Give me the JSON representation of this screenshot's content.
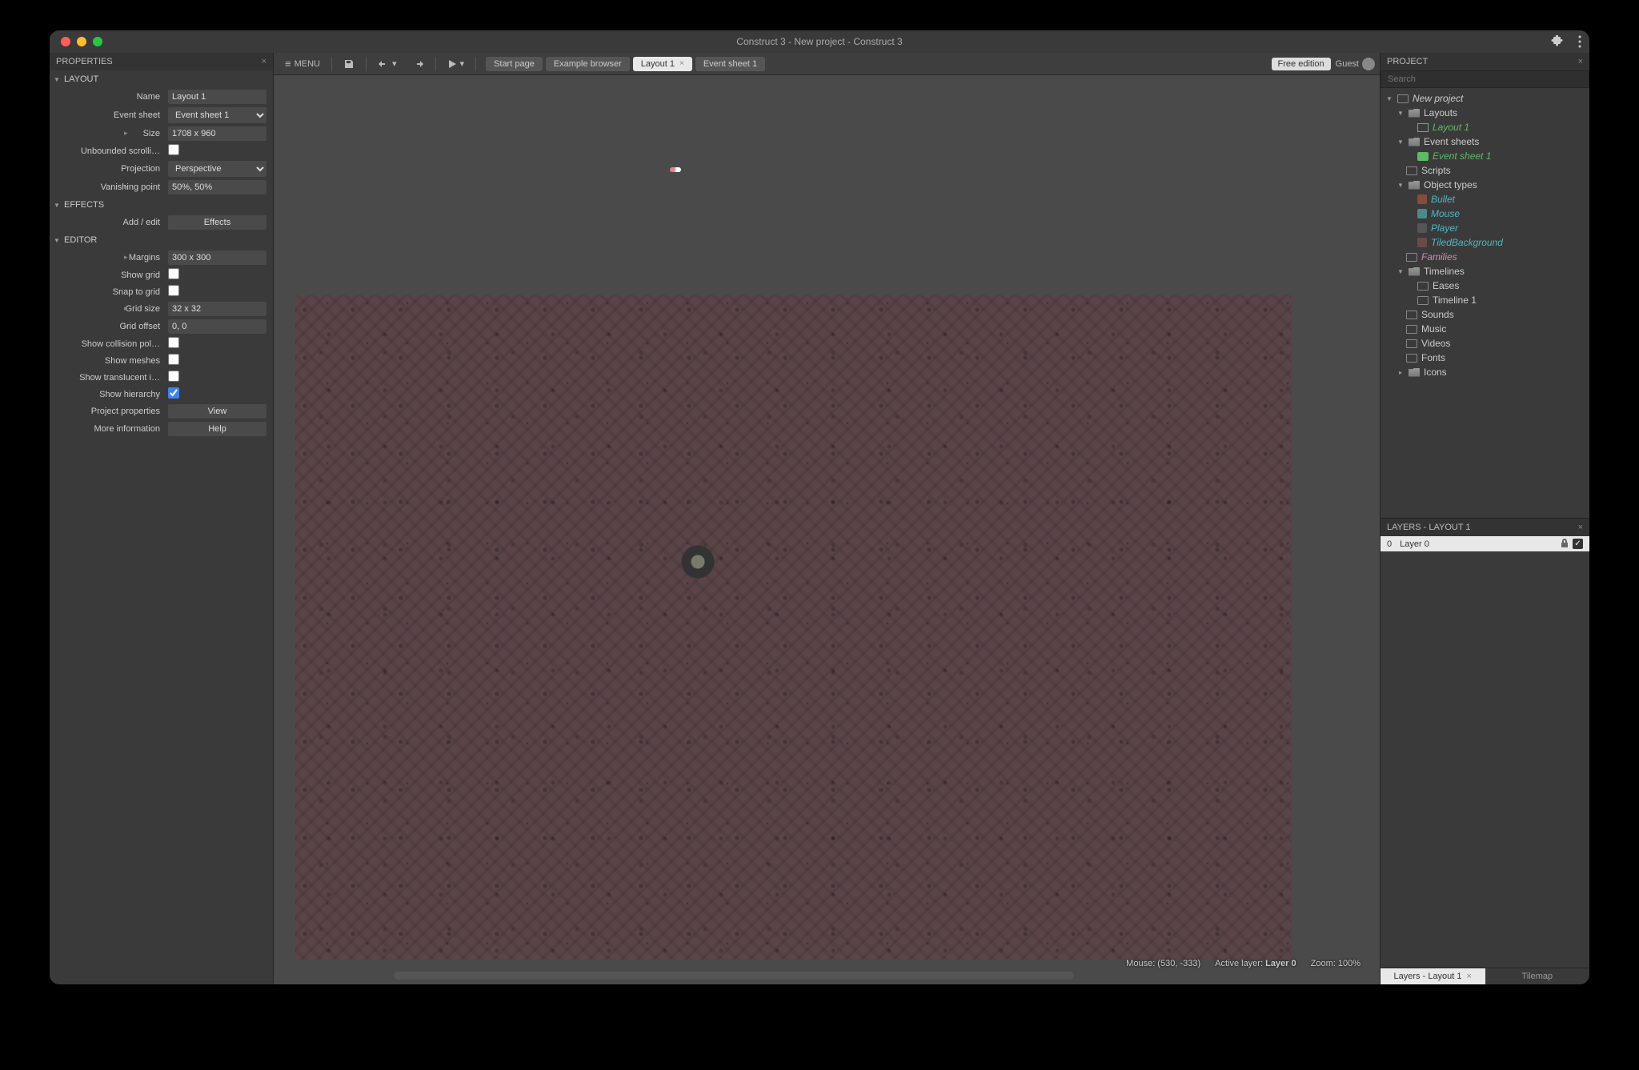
{
  "titlebar": {
    "title": "Construct 3 - New project - Construct 3"
  },
  "panels": {
    "properties": "PROPERTIES",
    "project": "PROJECT",
    "layers": "LAYERS - LAYOUT 1"
  },
  "properties": {
    "layout_section": "LAYOUT",
    "effects_section": "EFFECTS",
    "editor_section": "EDITOR",
    "labels": {
      "name": "Name",
      "event_sheet": "Event sheet",
      "size": "Size",
      "unbounded": "Unbounded scrolli…",
      "projection": "Projection",
      "vanishing": "Vanishing point",
      "add_edit": "Add / edit",
      "margins": "Margins",
      "show_grid": "Show grid",
      "snap_grid": "Snap to grid",
      "grid_size": "Grid size",
      "grid_offset": "Grid offset",
      "show_collision": "Show collision pol…",
      "show_meshes": "Show meshes",
      "show_translucent": "Show translucent i…",
      "show_hierarchy": "Show hierarchy",
      "project_props": "Project properties",
      "more_info": "More information"
    },
    "values": {
      "name": "Layout 1",
      "event_sheet": "Event sheet 1",
      "size": "1708 x 960",
      "projection": "Perspective",
      "vanishing": "50%, 50%",
      "effects_btn": "Effects",
      "margins": "300 x 300",
      "grid_size": "32 x 32",
      "grid_offset": "0, 0",
      "view_btn": "View",
      "help_btn": "Help"
    }
  },
  "toolbar": {
    "menu": "MENU",
    "tabs": {
      "start": "Start page",
      "example": "Example browser",
      "layout1": "Layout 1",
      "event1": "Event sheet 1"
    },
    "free": "Free edition",
    "guest": "Guest"
  },
  "status": {
    "mouse": "Mouse: (530, -333)",
    "layer_label": "Active layer:",
    "layer_val": "Layer 0",
    "zoom": "Zoom: 100%"
  },
  "project_tree": {
    "search_placeholder": "Search",
    "root": "New project",
    "layouts": "Layouts",
    "layout1": "Layout 1",
    "event_sheets": "Event sheets",
    "event1": "Event sheet 1",
    "scripts": "Scripts",
    "object_types": "Object types",
    "bullet": "Bullet",
    "mouse": "Mouse",
    "player": "Player",
    "tiledbg": "TiledBackground",
    "families": "Families",
    "timelines": "Timelines",
    "eases": "Eases",
    "timeline1": "Timeline 1",
    "sounds": "Sounds",
    "music": "Music",
    "videos": "Videos",
    "fonts": "Fonts",
    "icons": "Icons"
  },
  "layers": {
    "num": "0",
    "name": "Layer 0"
  },
  "bottom_tabs": {
    "layers": "Layers - Layout 1",
    "tilemap": "Tilemap"
  }
}
